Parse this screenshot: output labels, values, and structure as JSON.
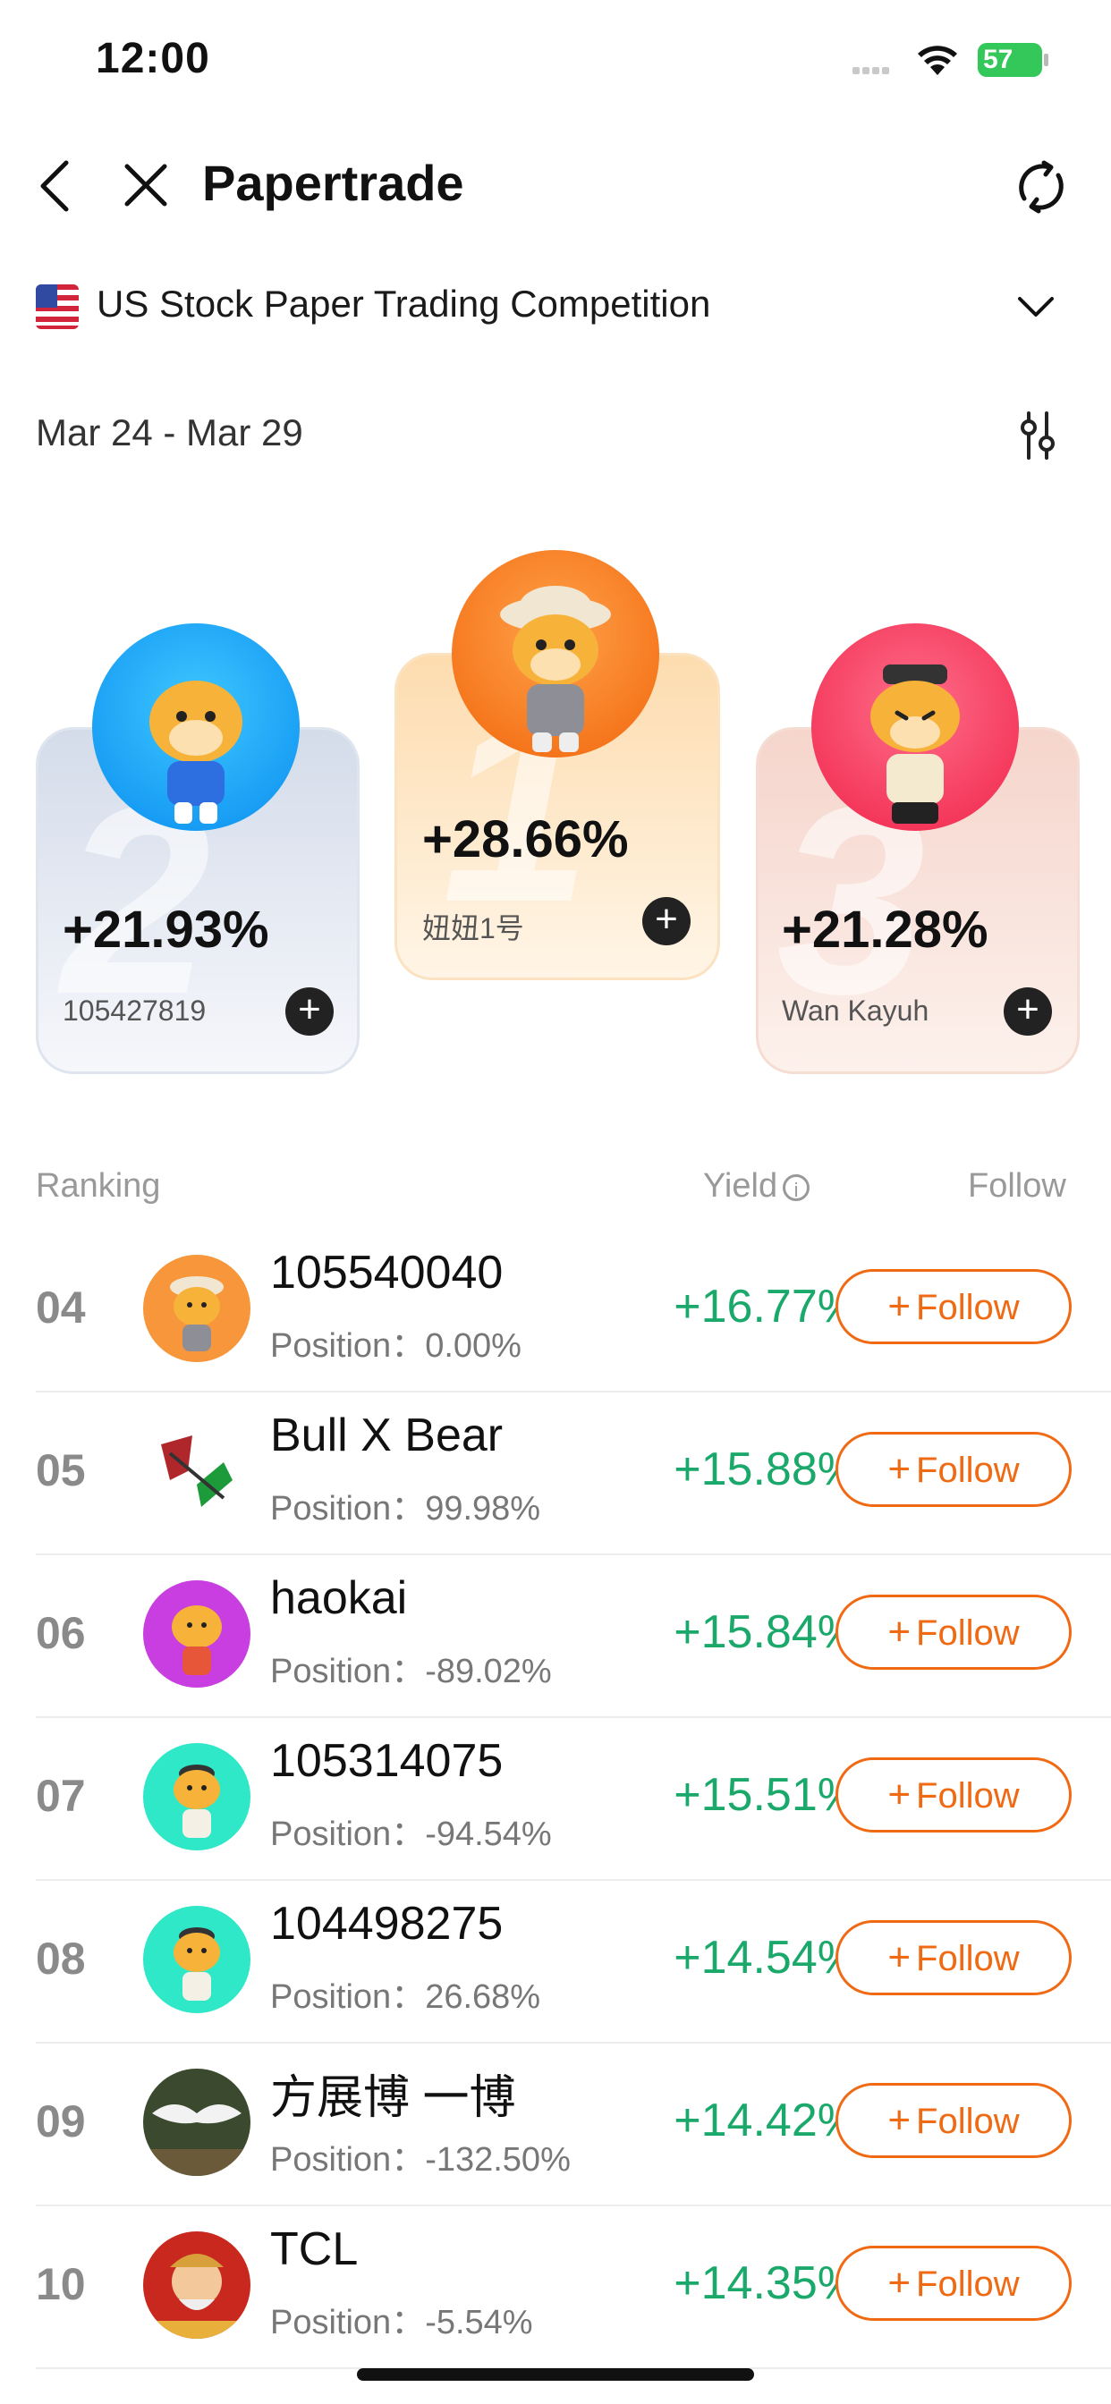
{
  "status_bar": {
    "time": "12:00",
    "battery": "57"
  },
  "nav": {
    "title": "Papertrade"
  },
  "competition": {
    "name": "US Stock Paper Trading Competition",
    "date_range": "Mar 24 - Mar 29"
  },
  "podium": [
    {
      "rank": "2",
      "yield": "+21.93%",
      "name": "105427819"
    },
    {
      "rank": "1",
      "yield": "+28.66%",
      "name": "妞妞1号"
    },
    {
      "rank": "3",
      "yield": "+21.28%",
      "name": "Wan Kayuh"
    }
  ],
  "ranking_header": {
    "ranking": "Ranking",
    "yield": "Yield",
    "follow": "Follow"
  },
  "follow_label": "Follow",
  "rows": [
    {
      "rank": "04",
      "name": "105540040",
      "position": "Position：0.00%",
      "yield": "+16.77%"
    },
    {
      "rank": "05",
      "name": "Bull X Bear",
      "position": "Position：99.98%",
      "yield": "+15.88%"
    },
    {
      "rank": "06",
      "name": "haokai",
      "position": "Position：-89.02%",
      "yield": "+15.84%"
    },
    {
      "rank": "07",
      "name": "105314075",
      "position": "Position：-94.54%",
      "yield": "+15.51%"
    },
    {
      "rank": "08",
      "name": "104498275",
      "position": "Position：26.68%",
      "yield": "+14.54%"
    },
    {
      "rank": "09",
      "name": "方展博 一博",
      "position": "Position：-132.50%",
      "yield": "+14.42%"
    },
    {
      "rank": "10",
      "name": "TCL",
      "position": "Position：-5.54%",
      "yield": "+14.35%"
    }
  ],
  "colors": {
    "accent": "#f06a14",
    "positive": "#1aa86b"
  }
}
